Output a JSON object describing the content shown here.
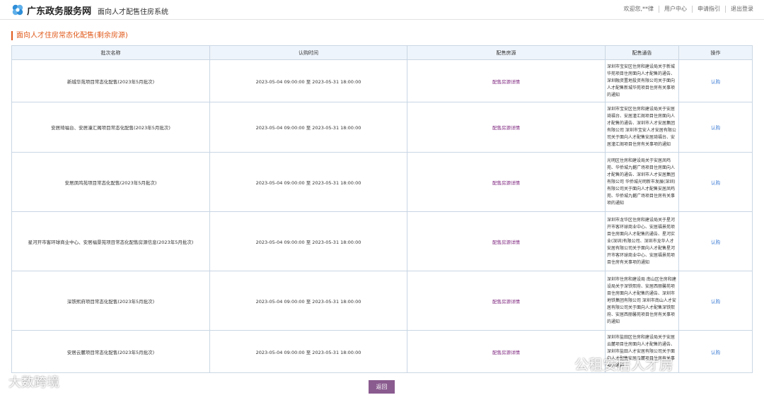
{
  "header": {
    "brand": "广东政务服务网",
    "system_title": "面向人才配售住房系统",
    "links": [
      "欢迎您,**律",
      "用户中心",
      "申请指引",
      "退出登录"
    ]
  },
  "section_title": "面向人才住房常态化配售(剩余房源)",
  "table": {
    "columns": [
      "批次名称",
      "认购时间",
      "配售房源",
      "配售通告",
      "操作"
    ],
    "rows": [
      {
        "batch": "新城华苑项目常态化配售(2023年5月批次)",
        "time": "2023-05-04 09:00:00 至 2023-05-31 18:00:00",
        "housing": "配售房源详情",
        "notice": "深圳市宝安区住房和建设局关于新城华苑项目住房面向人才配售的通告、深圳融资置地投资有限公司关于面向人才配售新城华苑项目住房有关事项的通知",
        "action": "认购"
      },
      {
        "batch": "安居琦福台、安居潼汇阁项目常态化配售(2023年5月批次)",
        "time": "2023-05-04 09:00:00 至 2023-05-31 18:00:00",
        "housing": "配售房源详情",
        "notice": "深圳市宝安区住房和建设局关于安居琦福台、安居潼汇阁项目住房面向人才配售的通告、深圳市人才安居集团有限公司 深圳市宝安人才安居有限公司关于面向人才配售安居琦福台、安居潼汇阁项目住房有关事项的通知",
        "action": "认购"
      },
      {
        "batch": "安居凤鸣苑项目常态化配售(2023年5月批次)",
        "time": "2023-05-04 09:00:00 至 2023-05-31 18:00:00",
        "housing": "配售房源详情",
        "notice": "光明区住房和建设局关于安居凤鸣苑、华侨城九樾广场项目住房面向人才配售的通告、深圳市人才安居集团有限公司 华侨城光明新市发展(深圳)有限公司关于面向人才配售安居凤鸣苑、华侨城九樾广场项目住房有关事项的通知",
        "action": "认购"
      },
      {
        "batch": "星河开市客环球商业中心、安居福景苑项目常态化配售房源信息(2023年5月批次)",
        "time": "2023-05-04 09:00:00 至 2023-05-31 18:00:00",
        "housing": "配售房源详情",
        "notice": "深圳市龙华区住房和建设局关于星河开市客环球商业中心、安居福景苑项目住房面向人才配售的通告、星河实业(深圳)有限公司、深圳市龙华人才安居有限公司关于面向人才配售星河开市客环球商业中心、安居福景苑项目住房有关事项的通知",
        "action": "认购"
      },
      {
        "batch": "深铁熙府项目常态化配售(2023年5月批次)",
        "time": "2023-05-04 09:00:00 至 2023-05-31 18:00:00",
        "housing": "配售房源详情",
        "notice": "深圳市住房和建设局 南山区住房和建设局关于深铁熙府、安居西丽馨苑项目住房面向人才配售的通告、深圳市地铁集团有限公司 深圳市南山人才安居有限公司关于面向人才配售深铁熙府、安居西丽馨苑项目住房有关事项的通知",
        "action": "认购"
      },
      {
        "batch": "安居云麓项目常态化配售(2023年5月批次)",
        "time": "2023-05-04 09:00:00 至 2023-05-31 18:00:00",
        "housing": "配售房源详情",
        "notice": "深圳市盐田区住房和建设局关于安居云麓项目住房面向人才配售的通告、深圳市盐田人才安居有限公司关于面向人才配售安居云麓项目住房有关事项的通知",
        "action": "认购"
      }
    ]
  },
  "back_label": "返回",
  "watermarks": [
    "大数跨境",
    "公租安居人才房"
  ]
}
